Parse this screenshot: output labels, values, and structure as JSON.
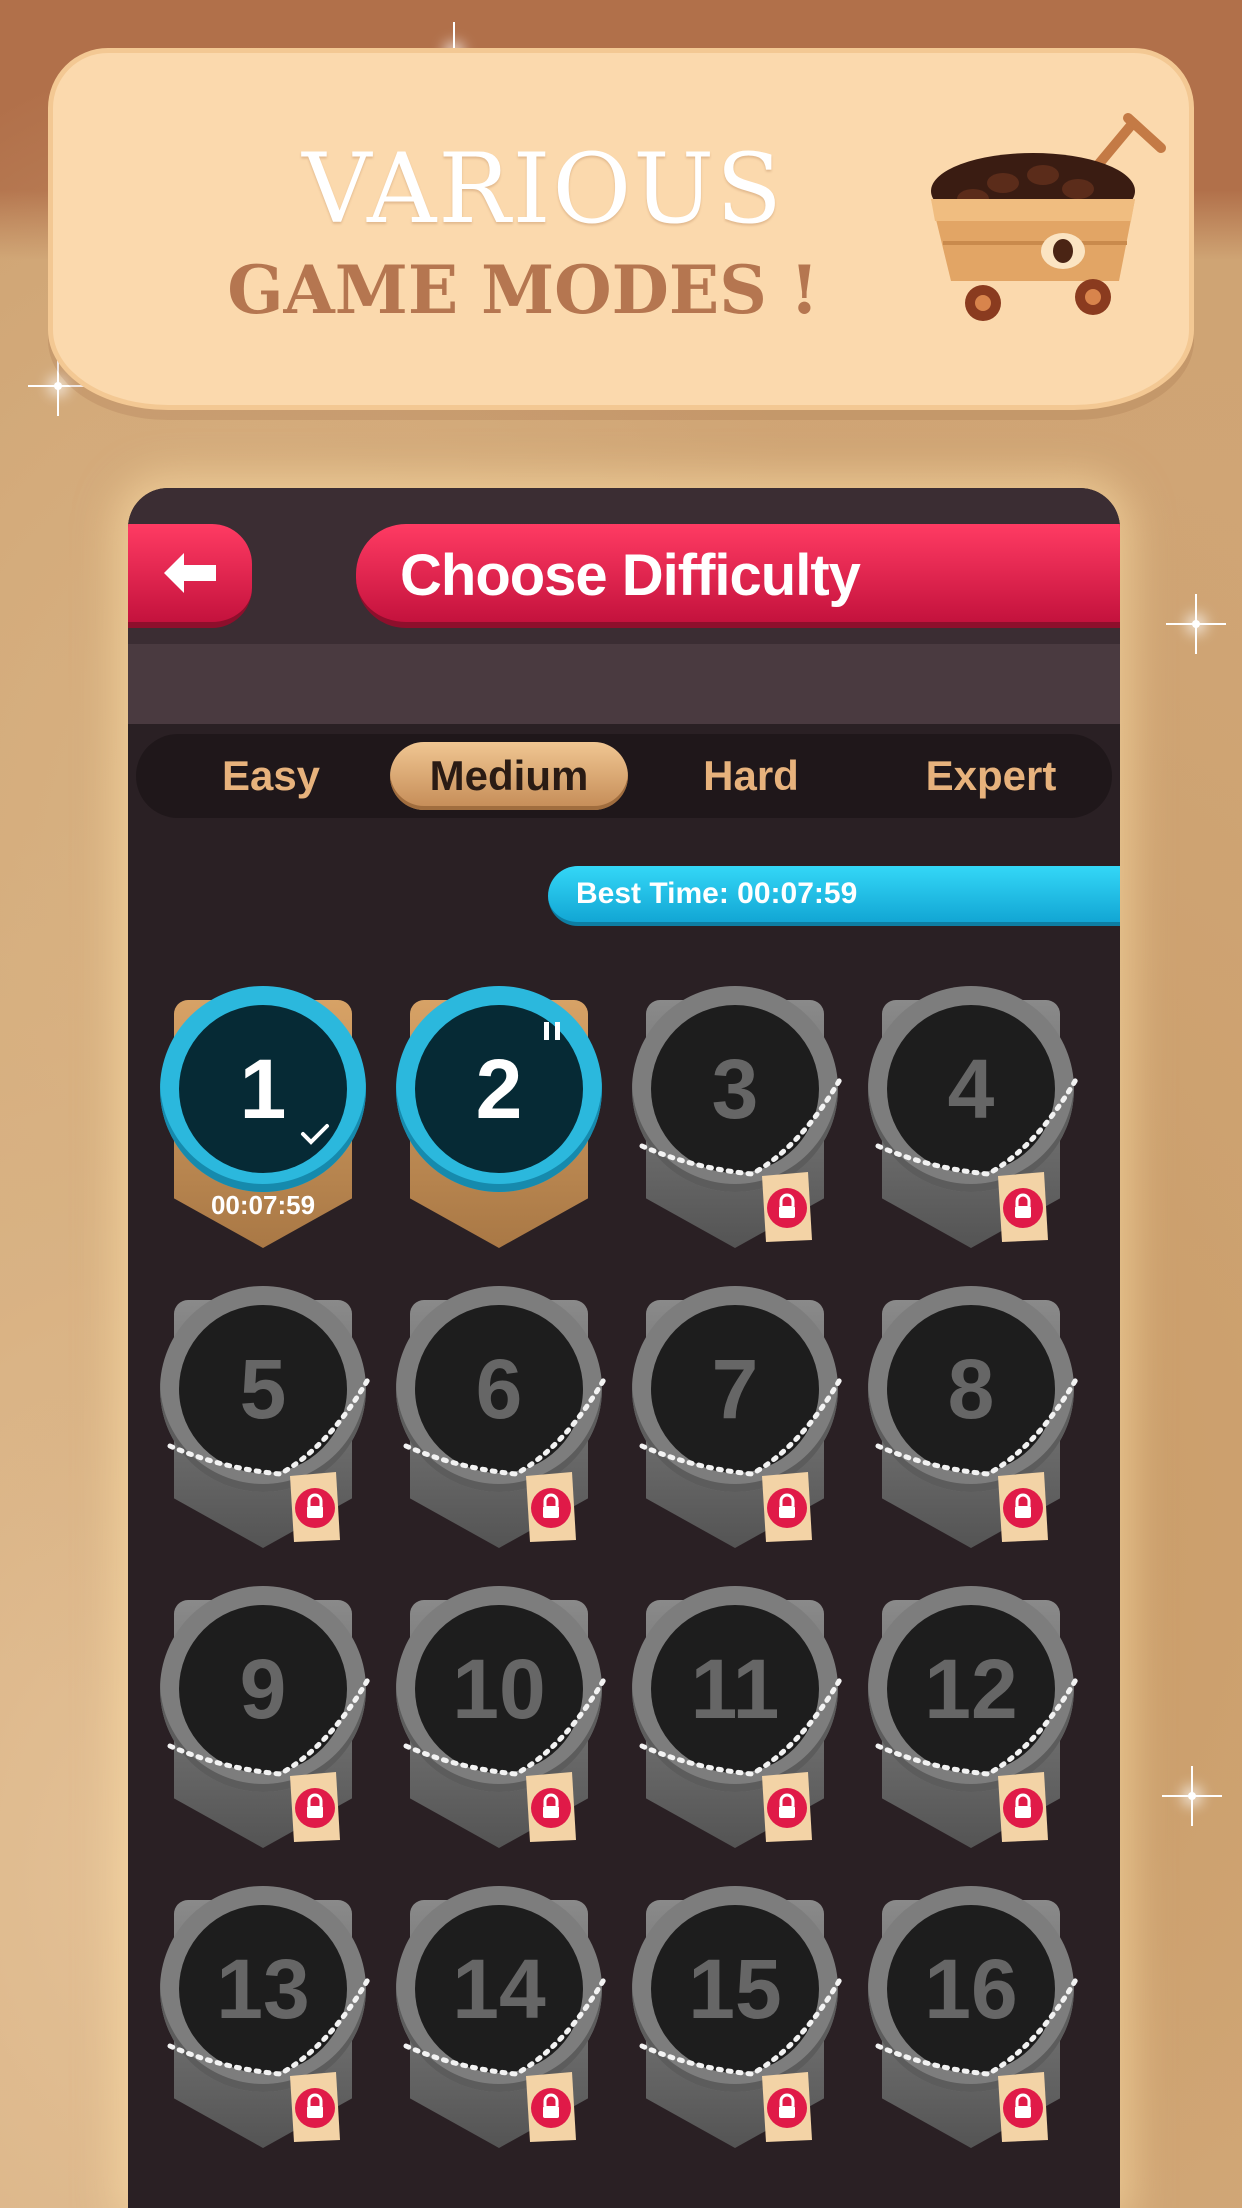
{
  "banner": {
    "line1": "VARIOUS",
    "line2": "GAME MODES !",
    "icon": "coffee-cart-icon"
  },
  "header": {
    "back_icon": "back-arrow-icon",
    "title": "Choose Difficulty"
  },
  "tabs": [
    {
      "label": "Easy",
      "active": false
    },
    {
      "label": "Medium",
      "active": true
    },
    {
      "label": "Hard",
      "active": false
    },
    {
      "label": "Expert",
      "active": false
    }
  ],
  "best_time": "Best Time: 00:07:59",
  "levels": [
    {
      "number": "1",
      "state": "completed",
      "time": "00:07:59"
    },
    {
      "number": "2",
      "state": "in-progress"
    },
    {
      "number": "3",
      "state": "locked"
    },
    {
      "number": "4",
      "state": "locked"
    },
    {
      "number": "5",
      "state": "locked"
    },
    {
      "number": "6",
      "state": "locked"
    },
    {
      "number": "7",
      "state": "locked"
    },
    {
      "number": "8",
      "state": "locked"
    },
    {
      "number": "9",
      "state": "locked"
    },
    {
      "number": "10",
      "state": "locked"
    },
    {
      "number": "11",
      "state": "locked"
    },
    {
      "number": "12",
      "state": "locked"
    },
    {
      "number": "13",
      "state": "locked"
    },
    {
      "number": "14",
      "state": "locked"
    },
    {
      "number": "15",
      "state": "locked"
    },
    {
      "number": "16",
      "state": "locked"
    }
  ],
  "colors": {
    "accent_red": "#e01a48",
    "accent_cyan": "#2bb8dd",
    "tab_text": "#e7b27c",
    "panel_bg": "#2a2024"
  }
}
